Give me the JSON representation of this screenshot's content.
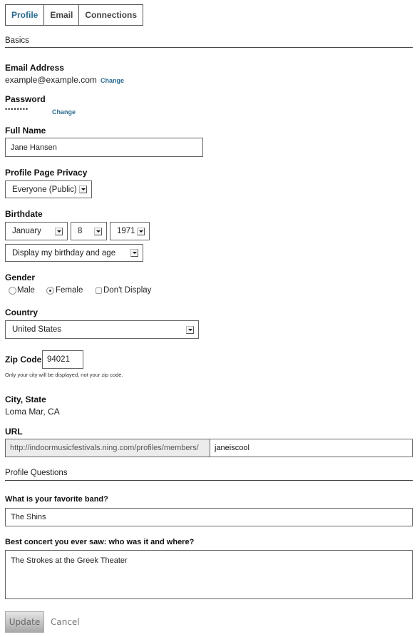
{
  "tabs": [
    {
      "label": "Profile",
      "active": true
    },
    {
      "label": "Email",
      "active": false
    },
    {
      "label": "Connections",
      "active": false
    }
  ],
  "basics": {
    "section_title": "Basics",
    "email": {
      "label": "Email Address",
      "value": "example@example.com",
      "change_link": "Change"
    },
    "password": {
      "label": "Password",
      "value": "••••••••",
      "change_link": "Change"
    },
    "full_name": {
      "label": "Full Name",
      "value": "Jane Hansen"
    },
    "privacy": {
      "label": "Profile Page Privacy",
      "selected": "Everyone (Public)"
    },
    "birthdate": {
      "label": "Birthdate",
      "month": "January",
      "day": "8",
      "year": "1971",
      "display": "Display my birthday and age"
    },
    "gender": {
      "label": "Gender",
      "options": [
        {
          "label": "Male",
          "type": "radio",
          "checked": false
        },
        {
          "label": "Female",
          "type": "radio",
          "checked": true
        },
        {
          "label": "Don't Display",
          "type": "checkbox",
          "checked": false
        }
      ]
    },
    "country": {
      "label": "Country",
      "selected": "United States"
    },
    "zip": {
      "label": "Zip Code",
      "value": "94021",
      "hint": "Only your city will be displayed, not your zip code."
    },
    "city_state": {
      "label": "City, State",
      "value": "Loma Mar, CA"
    },
    "url": {
      "label": "URL",
      "prefix": "http://indoormusicfestivals.ning.com/profiles/members/",
      "value": "janeiscool"
    }
  },
  "profile_questions": {
    "section_title": "Profile Questions",
    "questions": [
      {
        "label": "What is your favorite band?",
        "value": "The Shins"
      },
      {
        "label": "Best concert you ever saw: who was it and where?",
        "value": "The Strokes at the Greek Theater"
      }
    ]
  },
  "actions": {
    "update_label": "Update",
    "cancel_label": "Cancel"
  }
}
